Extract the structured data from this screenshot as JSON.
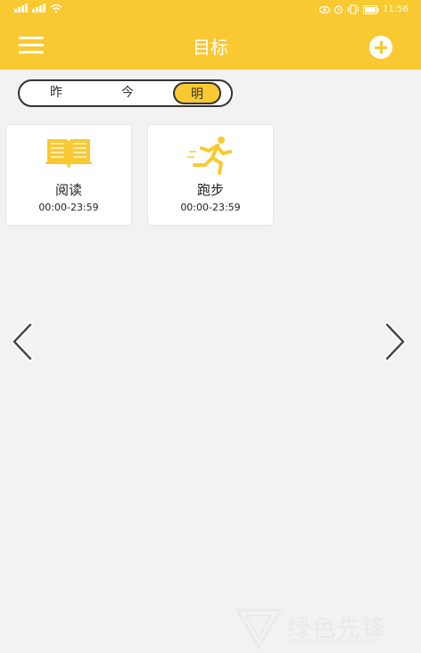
{
  "status_bar": {
    "left_icons": [
      "signal-icon",
      "signal-icon",
      "wifi-icon"
    ],
    "right_icons": [
      "eye-icon",
      "alarm-icon",
      "vibrate-icon",
      "battery-icon"
    ],
    "time": "11:56"
  },
  "header": {
    "title": "目标",
    "menu_icon": "hamburger-menu-icon",
    "add_icon": "plus-circle-icon",
    "background": "#f9c931"
  },
  "day_selector": {
    "options": [
      "昨",
      "今",
      "明"
    ],
    "selected": "明"
  },
  "goals": [
    {
      "icon": "book-icon",
      "name": "阅读",
      "time": "00:00-23:59"
    },
    {
      "icon": "running-icon",
      "name": "跑步",
      "time": "00:00-23:59"
    }
  ],
  "nav": {
    "prev_icon": "chevron-left-icon",
    "next_icon": "chevron-right-icon"
  },
  "watermark": {
    "text": "绿色先锋",
    "url": "www.greenxf.com"
  },
  "colors": {
    "accent": "#f9c931",
    "background": "#f2f2f2"
  }
}
